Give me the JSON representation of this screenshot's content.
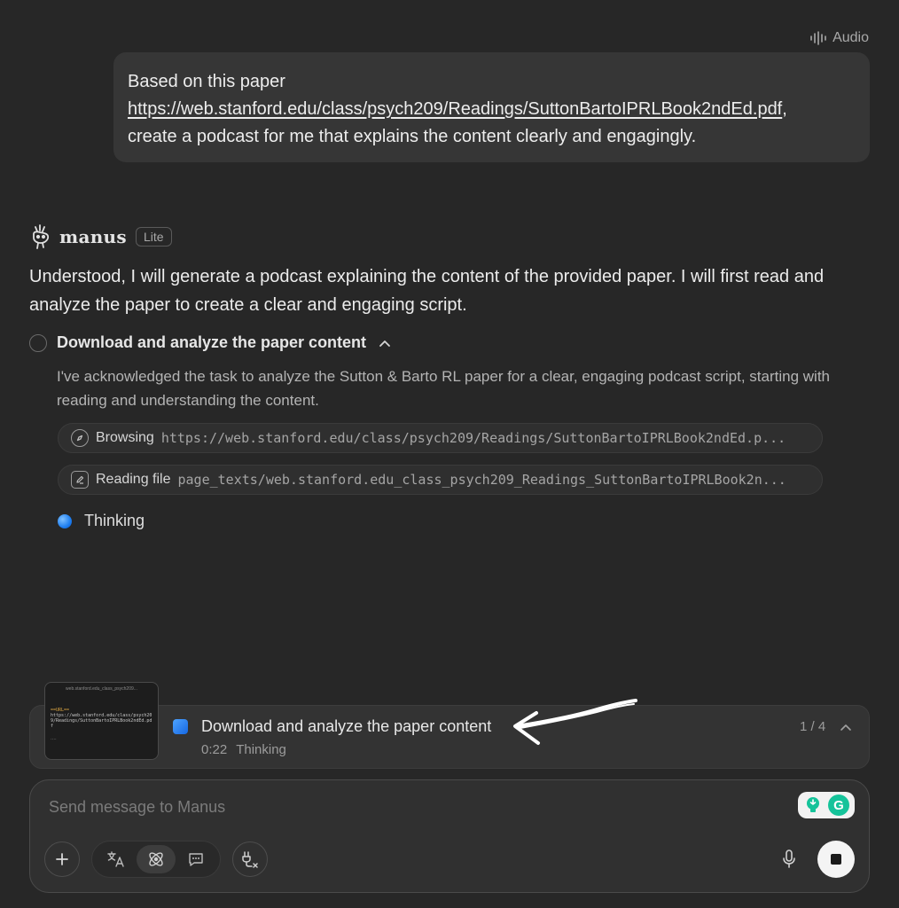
{
  "header": {
    "audio_label": "Audio"
  },
  "user_message": {
    "line1": "Based on this paper",
    "link": "https://web.stanford.edu/class/psych209/Readings/SuttonBartoIPRLBook2ndEd.pdf",
    "link_suffix": ",",
    "line3": "create a podcast for me that explains the content clearly and engagingly."
  },
  "assistant": {
    "name": "manus",
    "badge": "Lite",
    "reply": "Understood, I will generate a podcast explaining the content of the provided paper. I will first read and analyze the paper to create a clear and engaging script."
  },
  "step": {
    "title": "Download and analyze the paper content",
    "description": "I've acknowledged the task to analyze the Sutton & Barto RL paper for a clear, engaging podcast script, starting with reading and understanding the content.",
    "tools": [
      {
        "label": "Browsing",
        "detail": "https://web.stanford.edu/class/psych209/Readings/SuttonBartoIPRLBook2ndEd.p...",
        "icon": "compass-icon"
      },
      {
        "label": "Reading file",
        "detail": "page_texts/web.stanford.edu_class_psych209_Readings_SuttonBartoIPRLBook2n...",
        "icon": "edit-icon"
      }
    ],
    "thinking_label": "Thinking"
  },
  "progress": {
    "thumbnail_title": "web.stanford.edu_class_psych209...",
    "thumbnail_tag": "==URL==",
    "thumbnail_body": "https://web.stanford.edu/class/psych209/Readings/SuttonBartoIPRLBook2ndEd.pdf",
    "thumbnail_dots": "....",
    "title": "Download and analyze the paper content",
    "time": "0:22",
    "status": "Thinking",
    "count": "1 / 4"
  },
  "composer": {
    "placeholder": "Send message to Manus"
  },
  "colors": {
    "background": "#272727",
    "bubble": "#363636",
    "accent_blue": "#1e7ef0",
    "grammarly_green": "#15c39a"
  }
}
